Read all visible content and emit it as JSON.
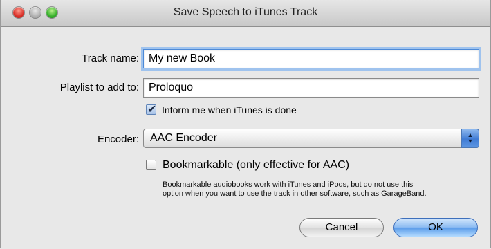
{
  "window": {
    "title": "Save Speech to iTunes Track"
  },
  "form": {
    "track_name_label": "Track name:",
    "track_name_value": "My new Book",
    "playlist_label": "Playlist to add to:",
    "playlist_value": "Proloquo",
    "inform_label": "Inform me when iTunes is done",
    "inform_checked": true,
    "encoder_label": "Encoder:",
    "encoder_value": "AAC Encoder",
    "bookmarkable_label": "Bookmarkable (only effective for AAC)",
    "bookmarkable_checked": false,
    "help_line1": "Bookmarkable audiobooks work with iTunes and iPods, but do not use this",
    "help_line2": "option when you want to use the track in other software, such as GarageBand."
  },
  "buttons": {
    "cancel_label": "Cancel",
    "ok_label": "OK"
  },
  "icons": {
    "checkmark": "✔",
    "arrow_up": "▲",
    "arrow_down": "▼"
  },
  "colors": {
    "focus_ring": "#9fc3ee",
    "default_button": "#5a9be9",
    "close_light": "#d9312a",
    "zoom_light": "#37b02c"
  }
}
